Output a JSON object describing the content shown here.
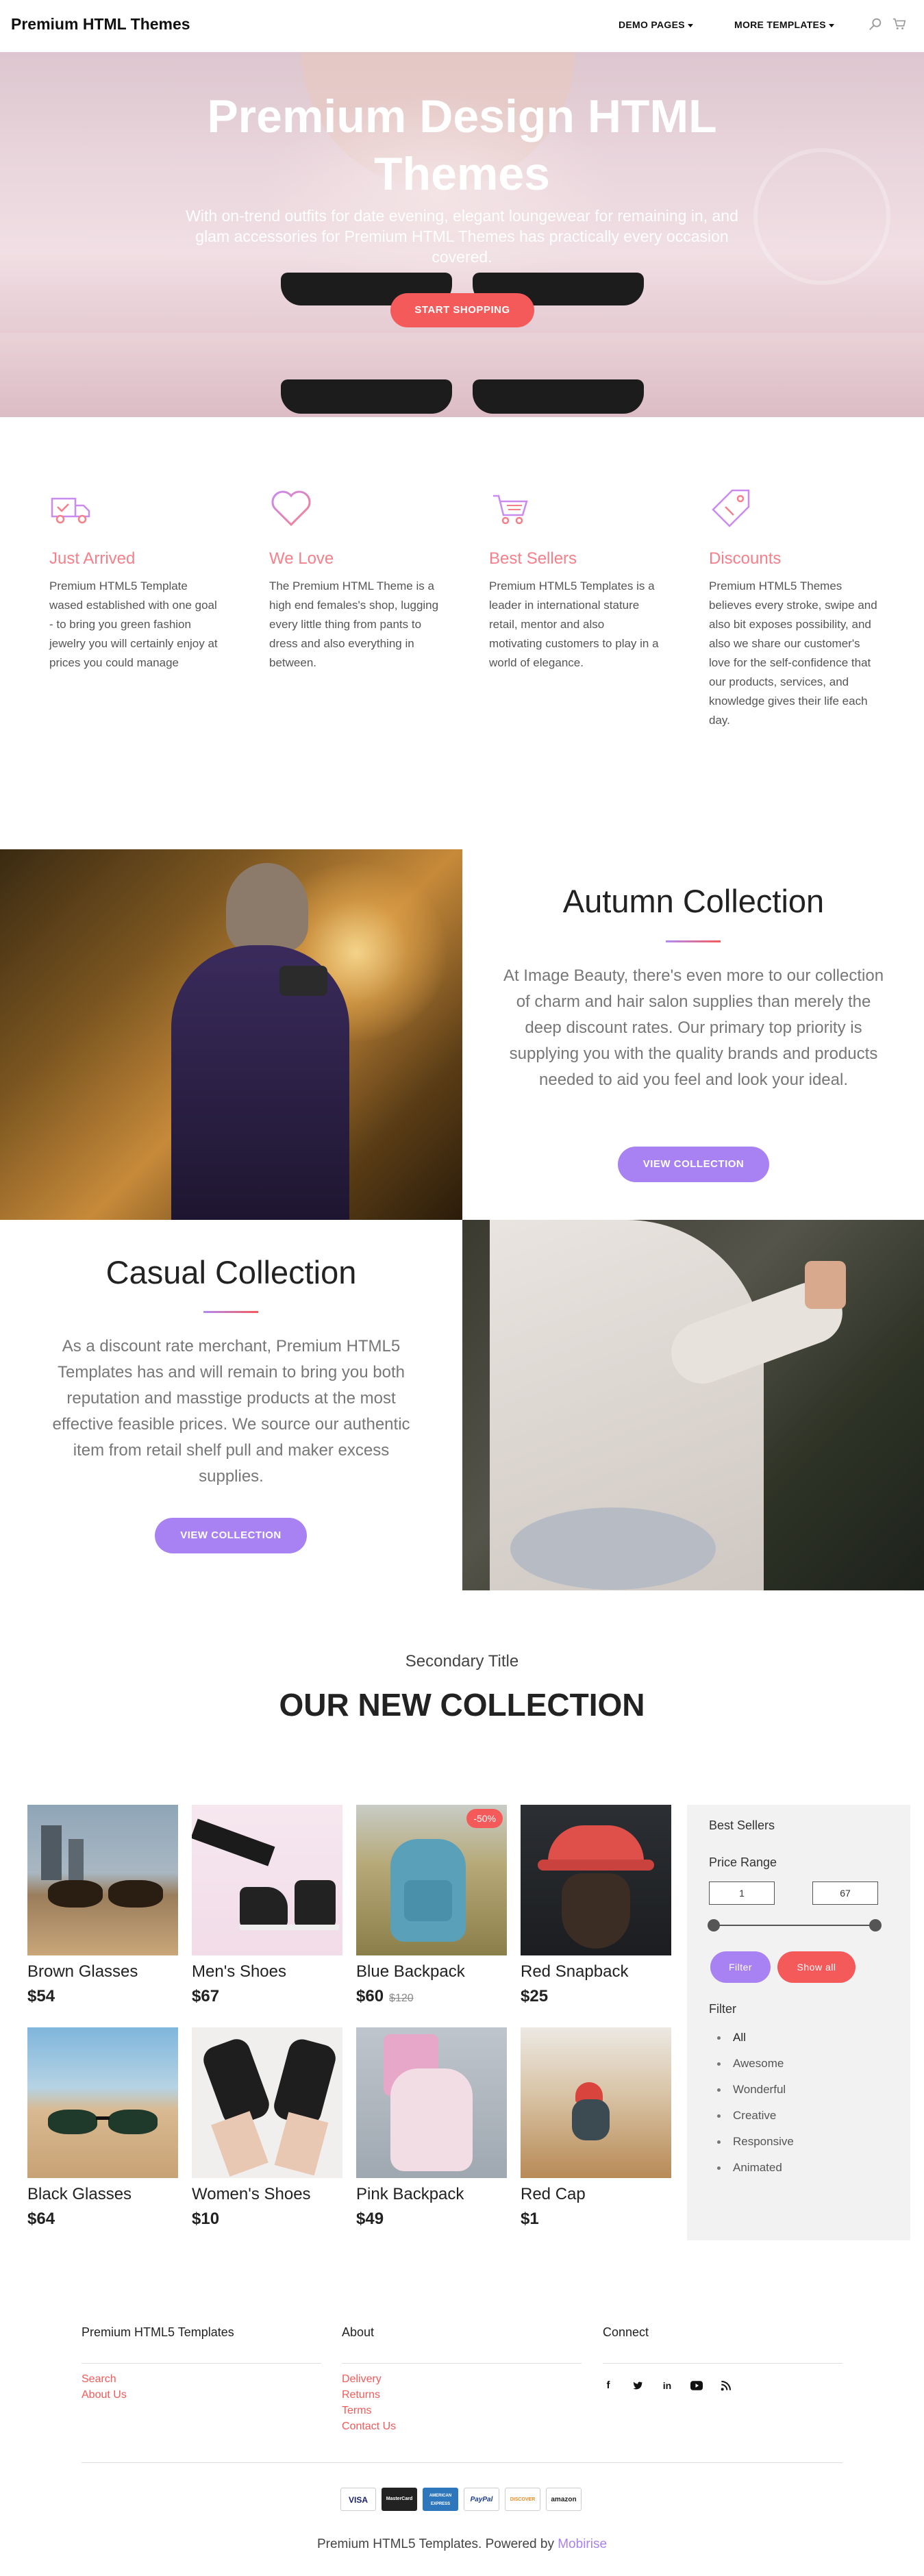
{
  "nav": {
    "brand": "Premium HTML Themes",
    "links": [
      {
        "label": "DEMO PAGES"
      },
      {
        "label": "MORE TEMPLATES"
      }
    ],
    "icons": [
      "search-icon",
      "cart-icon"
    ]
  },
  "hero": {
    "title": "Premium Design HTML Themes",
    "text": "With on-trend outfits for date evening, elegant loungewear for remaining in, and glam accessories for Premium HTML Themes has practically every occasion covered.",
    "button": "START SHOPPING"
  },
  "features": [
    {
      "icon": "delivery-truck-icon",
      "title": "Just Arrived",
      "text": "Premium HTML5 Template wased established with one goal - to bring you green fashion jewelry you will certainly enjoy at prices you could manage"
    },
    {
      "icon": "heart-icon",
      "title": "We Love",
      "text": "The Premium HTML Theme is a high end females's shop, lugging every little thing from pants to dress and also everything in between."
    },
    {
      "icon": "cart-icon",
      "title": "Best Sellers",
      "text": "Premium HTML5 Templates is a leader in international stature retail, mentor and also motivating customers to play in a world of elegance."
    },
    {
      "icon": "price-tag-icon",
      "title": "Discounts",
      "text": "Premium HTML5 Themes believes every stroke, swipe and also bit exposes possibility, and also we share our customer's love for the self-confidence that our products, services, and knowledge gives their life each day."
    }
  ],
  "autumn": {
    "title": "Autumn Collection",
    "text": "At Image Beauty, there's even more to our collection of charm and hair salon supplies than merely the deep discount rates. Our primary top priority is supplying you with the quality brands and products needed to aid you feel and look your ideal.",
    "button": "VIEW COLLECTION"
  },
  "casual": {
    "title": "Casual Collection",
    "text": "As a discount rate merchant, Premium HTML5 Templates has and will remain to bring you both reputation and masstige products at the most effective feasible prices. We source our authentic item from retail shelf pull and maker excess supplies.",
    "button": "VIEW COLLECTION"
  },
  "shop": {
    "secondary_title": "Secondary Title",
    "title": "OUR NEW COLLECTION",
    "products": [
      {
        "name": "Brown Glasses",
        "price": "$54",
        "old_price": "",
        "badge": ""
      },
      {
        "name": "Men's Shoes",
        "price": "$67",
        "old_price": "",
        "badge": ""
      },
      {
        "name": "Blue Backpack",
        "price": "$60",
        "old_price": "$120",
        "badge": "-50%"
      },
      {
        "name": "Red Snapback",
        "price": "$25",
        "old_price": "",
        "badge": ""
      },
      {
        "name": "Black Glasses",
        "price": "$64",
        "old_price": "",
        "badge": ""
      },
      {
        "name": "Women's Shoes",
        "price": "$10",
        "old_price": "",
        "badge": ""
      },
      {
        "name": "Pink Backpack",
        "price": "$49",
        "old_price": "",
        "badge": ""
      },
      {
        "name": "Red Cap",
        "price": "$1",
        "old_price": "",
        "badge": ""
      }
    ],
    "sidebar": {
      "best_sellers": "Best Sellers",
      "price_range": "Price Range",
      "min": "1",
      "max": "67",
      "filter_button": "Filter",
      "show_all_button": "Show all",
      "filter_label": "Filter",
      "filters": [
        "All",
        "Awesome",
        "Wonderful",
        "Creative",
        "Responsive",
        "Animated"
      ],
      "active_filter": "All"
    }
  },
  "footer": {
    "columns": [
      {
        "title": "Premium HTML5 Templates",
        "links": [
          "Search",
          "About Us"
        ]
      },
      {
        "title": "About",
        "links": [
          "Delivery",
          "Returns",
          "Terms",
          "Contact Us"
        ]
      },
      {
        "title": "Connect",
        "links": []
      }
    ],
    "social": [
      "facebook-icon",
      "twitter-icon",
      "linkedin-icon",
      "youtube-icon",
      "rss-icon"
    ],
    "payments": [
      "VISA",
      "MasterCard",
      "AMERICAN EXPRESS",
      "PayPal",
      "DISCOVER",
      "amazon"
    ],
    "copyright_text": "Premium HTML5 Templates. Powered by",
    "powered_by": "Mobirise"
  },
  "colors": {
    "accent_red": "#f55a5a",
    "accent_purple": "#a882f2",
    "feature_pink": "#f6808a"
  }
}
